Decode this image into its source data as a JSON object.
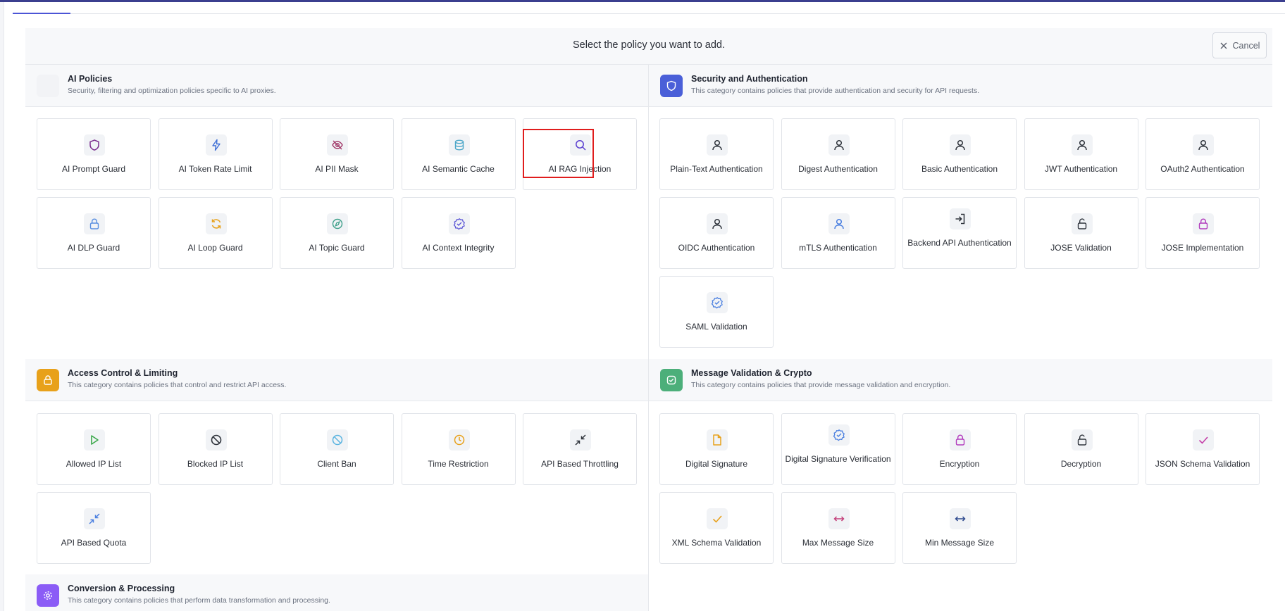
{
  "header": {
    "title": "Select the policy you want to add.",
    "cancel_label": "Cancel"
  },
  "sections": {
    "ai": {
      "title": "AI Policies",
      "desc": "Security, filtering and optimization policies specific to AI proxies.",
      "items": [
        "AI Prompt Guard",
        "AI Token Rate Limit",
        "AI PII Mask",
        "AI Semantic Cache",
        "AI RAG Injection",
        "AI DLP Guard",
        "AI Loop Guard",
        "AI Topic Guard",
        "AI Context Integrity"
      ]
    },
    "security": {
      "title": "Security and Authentication",
      "desc": "This category contains policies that provide authentication and security for API requests.",
      "items": [
        "Plain-Text Authentication",
        "Digest Authentication",
        "Basic Authentication",
        "JWT Authentication",
        "OAuth2 Authentication",
        "OIDC Authentication",
        "mTLS Authentication",
        "Backend API Authentication",
        "JOSE Validation",
        "JOSE Implementation",
        "SAML Validation"
      ]
    },
    "access": {
      "title": "Access Control & Limiting",
      "desc": "This category contains policies that control and restrict API access.",
      "items": [
        "Allowed IP List",
        "Blocked IP List",
        "Client Ban",
        "Time Restriction",
        "API Based Throttling",
        "API Based Quota"
      ]
    },
    "message": {
      "title": "Message Validation & Crypto",
      "desc": "This category contains policies that provide message validation and encryption.",
      "items": [
        "Digital Signature",
        "Digital Signature Verification",
        "Encryption",
        "Decryption",
        "JSON Schema Validation",
        "XML Schema Validation",
        "Max Message Size",
        "Min Message Size"
      ]
    },
    "conversion": {
      "title": "Conversion & Processing",
      "desc": "This category contains policies that perform data transformation and processing."
    }
  },
  "colors": {
    "accent": "#4b55d6",
    "highlight": "#e01d1d",
    "security": "#4a5fd8",
    "access": "#e8a11a",
    "message": "#4caf7a",
    "conversion": "#8b5cf6"
  }
}
